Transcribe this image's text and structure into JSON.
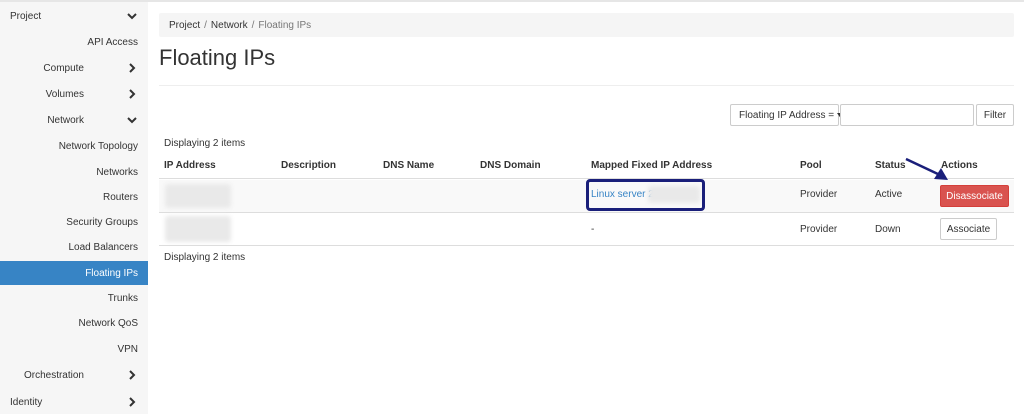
{
  "sidebar": {
    "project": "Project",
    "api_access": "API Access",
    "compute": "Compute",
    "volumes": "Volumes",
    "network": "Network",
    "network_topology": "Network Topology",
    "networks": "Networks",
    "routers": "Routers",
    "security_groups": "Security Groups",
    "load_balancers": "Load Balancers",
    "floating_ips": "Floating IPs",
    "trunks": "Trunks",
    "network_qos": "Network QoS",
    "vpn": "VPN",
    "orchestration": "Orchestration",
    "identity": "Identity"
  },
  "breadcrumb": {
    "project": "Project",
    "network": "Network",
    "current": "Floating IPs",
    "separator": "/"
  },
  "page": {
    "title": "Floating IPs"
  },
  "filter": {
    "select_label": "Floating IP Address =",
    "button": "Filter",
    "input_value": ""
  },
  "table": {
    "count_top": "Displaying 2 items",
    "count_bottom": "Displaying 2 items",
    "headers": {
      "ip": "IP Address",
      "description": "Description",
      "dns_name": "DNS Name",
      "dns_domain": "DNS Domain",
      "mapped": "Mapped Fixed IP Address",
      "pool": "Pool",
      "status": "Status",
      "actions": "Actions"
    },
    "rows": [
      {
        "mapped": "Linux server 2",
        "pool": "Provider",
        "status": "Active",
        "action": "Disassociate"
      },
      {
        "mapped": "-",
        "pool": "Provider",
        "status": "Down",
        "action": "Associate"
      }
    ]
  },
  "colors": {
    "active_nav": "#3784c5",
    "danger": "#d9534f",
    "link": "#3784c5",
    "annotation": "#1a1f7a"
  },
  "icons": {
    "chevron_down": "chevron-down-icon",
    "chevron_right": "chevron-right-icon",
    "caret_down": "caret-down-icon",
    "annotation_arrow": "arrow-icon"
  }
}
